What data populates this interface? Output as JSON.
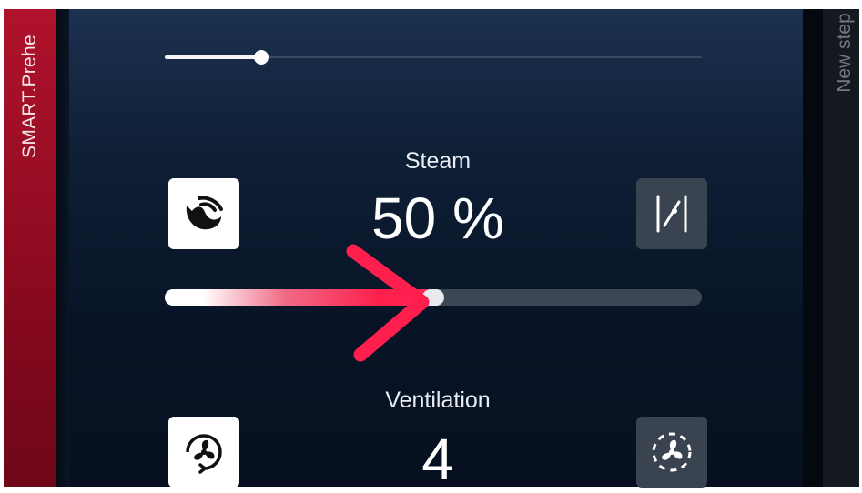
{
  "left_tab": {
    "label": "SMART.Prehe"
  },
  "right_tab": {
    "label": "New step"
  },
  "top_slider": {
    "value": 0.18
  },
  "steam": {
    "label": "Steam",
    "value_text": "50 %",
    "slider_value": 0.5,
    "left_icon": "steam-icon",
    "right_icon": "steam-scale-icon"
  },
  "ventilation": {
    "label": "Ventilation",
    "value_text": "4",
    "left_icon": "fan-rotation-icon",
    "right_icon": "fan-pulse-icon"
  },
  "colors": {
    "accent": "#ff2a55",
    "left_tab": "#a00f26",
    "panel": "#0a1626"
  }
}
